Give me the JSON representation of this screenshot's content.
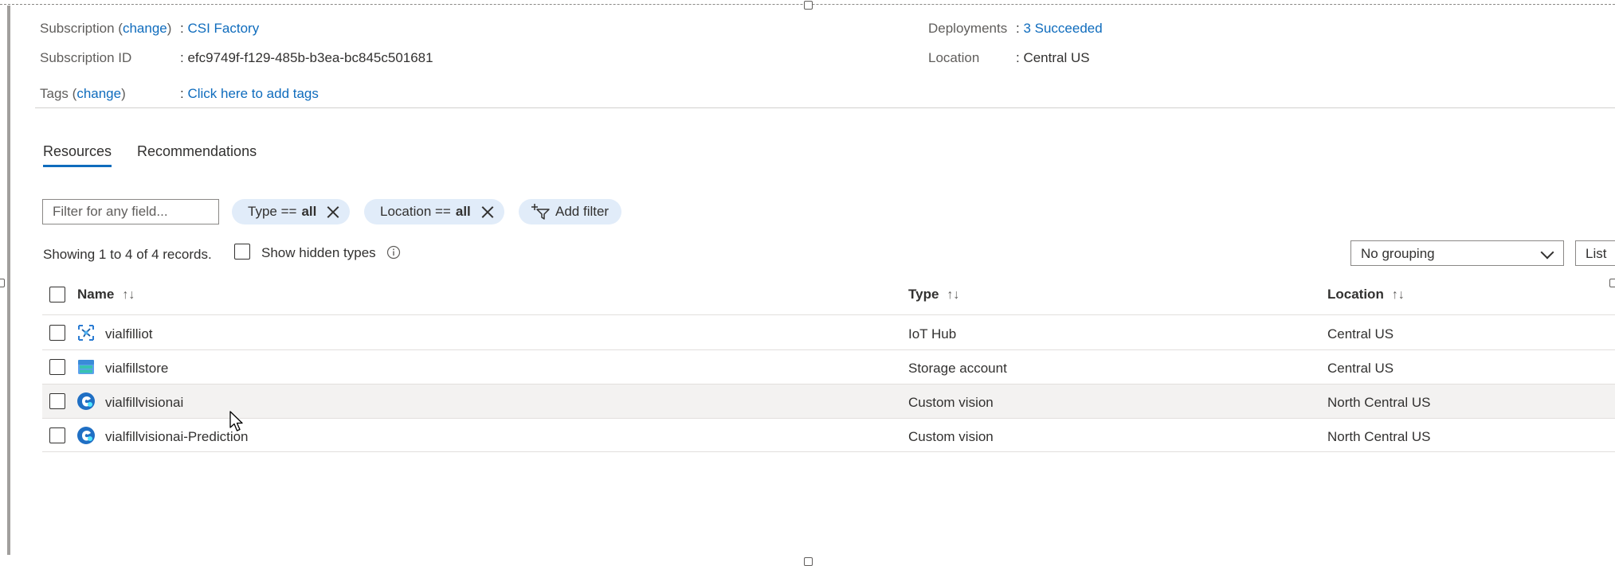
{
  "essentials": {
    "subscription_label": "Subscription",
    "subscription_change": "change",
    "subscription_value": "CSI Factory",
    "subscription_id_label": "Subscription ID",
    "subscription_id_value": "efc9749f-f129-485b-b3ea-bc845c501681",
    "tags_label": "Tags",
    "tags_change": "change",
    "tags_value": "Click here to add tags",
    "deployments_label": "Deployments",
    "deployments_value": "3 Succeeded",
    "location_label": "Location",
    "location_value": "Central US"
  },
  "tabs": [
    {
      "label": "Resources",
      "active": true
    },
    {
      "label": "Recommendations",
      "active": false
    }
  ],
  "filters": {
    "search_placeholder": "Filter for any field...",
    "type_filter": {
      "prefix": "Type ==",
      "value": "all"
    },
    "location_filter": {
      "prefix": "Location ==",
      "value": "all"
    },
    "add_filter_label": "Add filter"
  },
  "toolbar": {
    "showing_text": "Showing 1 to 4 of 4 records.",
    "show_hidden_label": "Show hidden types",
    "grouping_value": "No grouping",
    "view_label": "List"
  },
  "table": {
    "columns": [
      "Name",
      "Type",
      "Location"
    ],
    "rows": [
      {
        "name": "vialfilliot",
        "type": "IoT Hub",
        "location": "Central US",
        "icon": "iot-hub-icon"
      },
      {
        "name": "vialfillstore",
        "type": "Storage account",
        "location": "Central US",
        "icon": "storage-account-icon"
      },
      {
        "name": "vialfillvisionai",
        "type": "Custom vision",
        "location": "North Central US",
        "icon": "custom-vision-icon"
      },
      {
        "name": "vialfillvisionai-Prediction",
        "type": "Custom vision",
        "location": "North Central US",
        "icon": "custom-vision-icon"
      }
    ]
  },
  "colors": {
    "link": "#0f6cbd",
    "pill_bg": "#e1ecf9",
    "hover_row": "#f3f2f1"
  }
}
